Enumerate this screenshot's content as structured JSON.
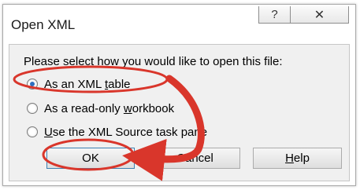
{
  "dialog": {
    "title": "Open XML",
    "help_icon_glyph": "?",
    "close_icon_glyph": "✕",
    "prompt": "Please select how you would like to open this file:",
    "options": [
      {
        "label_pre": "As an XML ",
        "label_key": "t",
        "label_post": "able",
        "selected": true
      },
      {
        "label_pre": "As a read-only ",
        "label_key": "w",
        "label_post": "orkbook",
        "selected": false
      },
      {
        "label_pre": "",
        "label_key": "U",
        "label_post": "se the XML Source task pane",
        "selected": false
      }
    ],
    "buttons": {
      "ok": "OK",
      "cancel": "Cancel",
      "help_key": "H",
      "help_rest": "elp"
    }
  },
  "annotation": {
    "color": "#d9362b"
  }
}
